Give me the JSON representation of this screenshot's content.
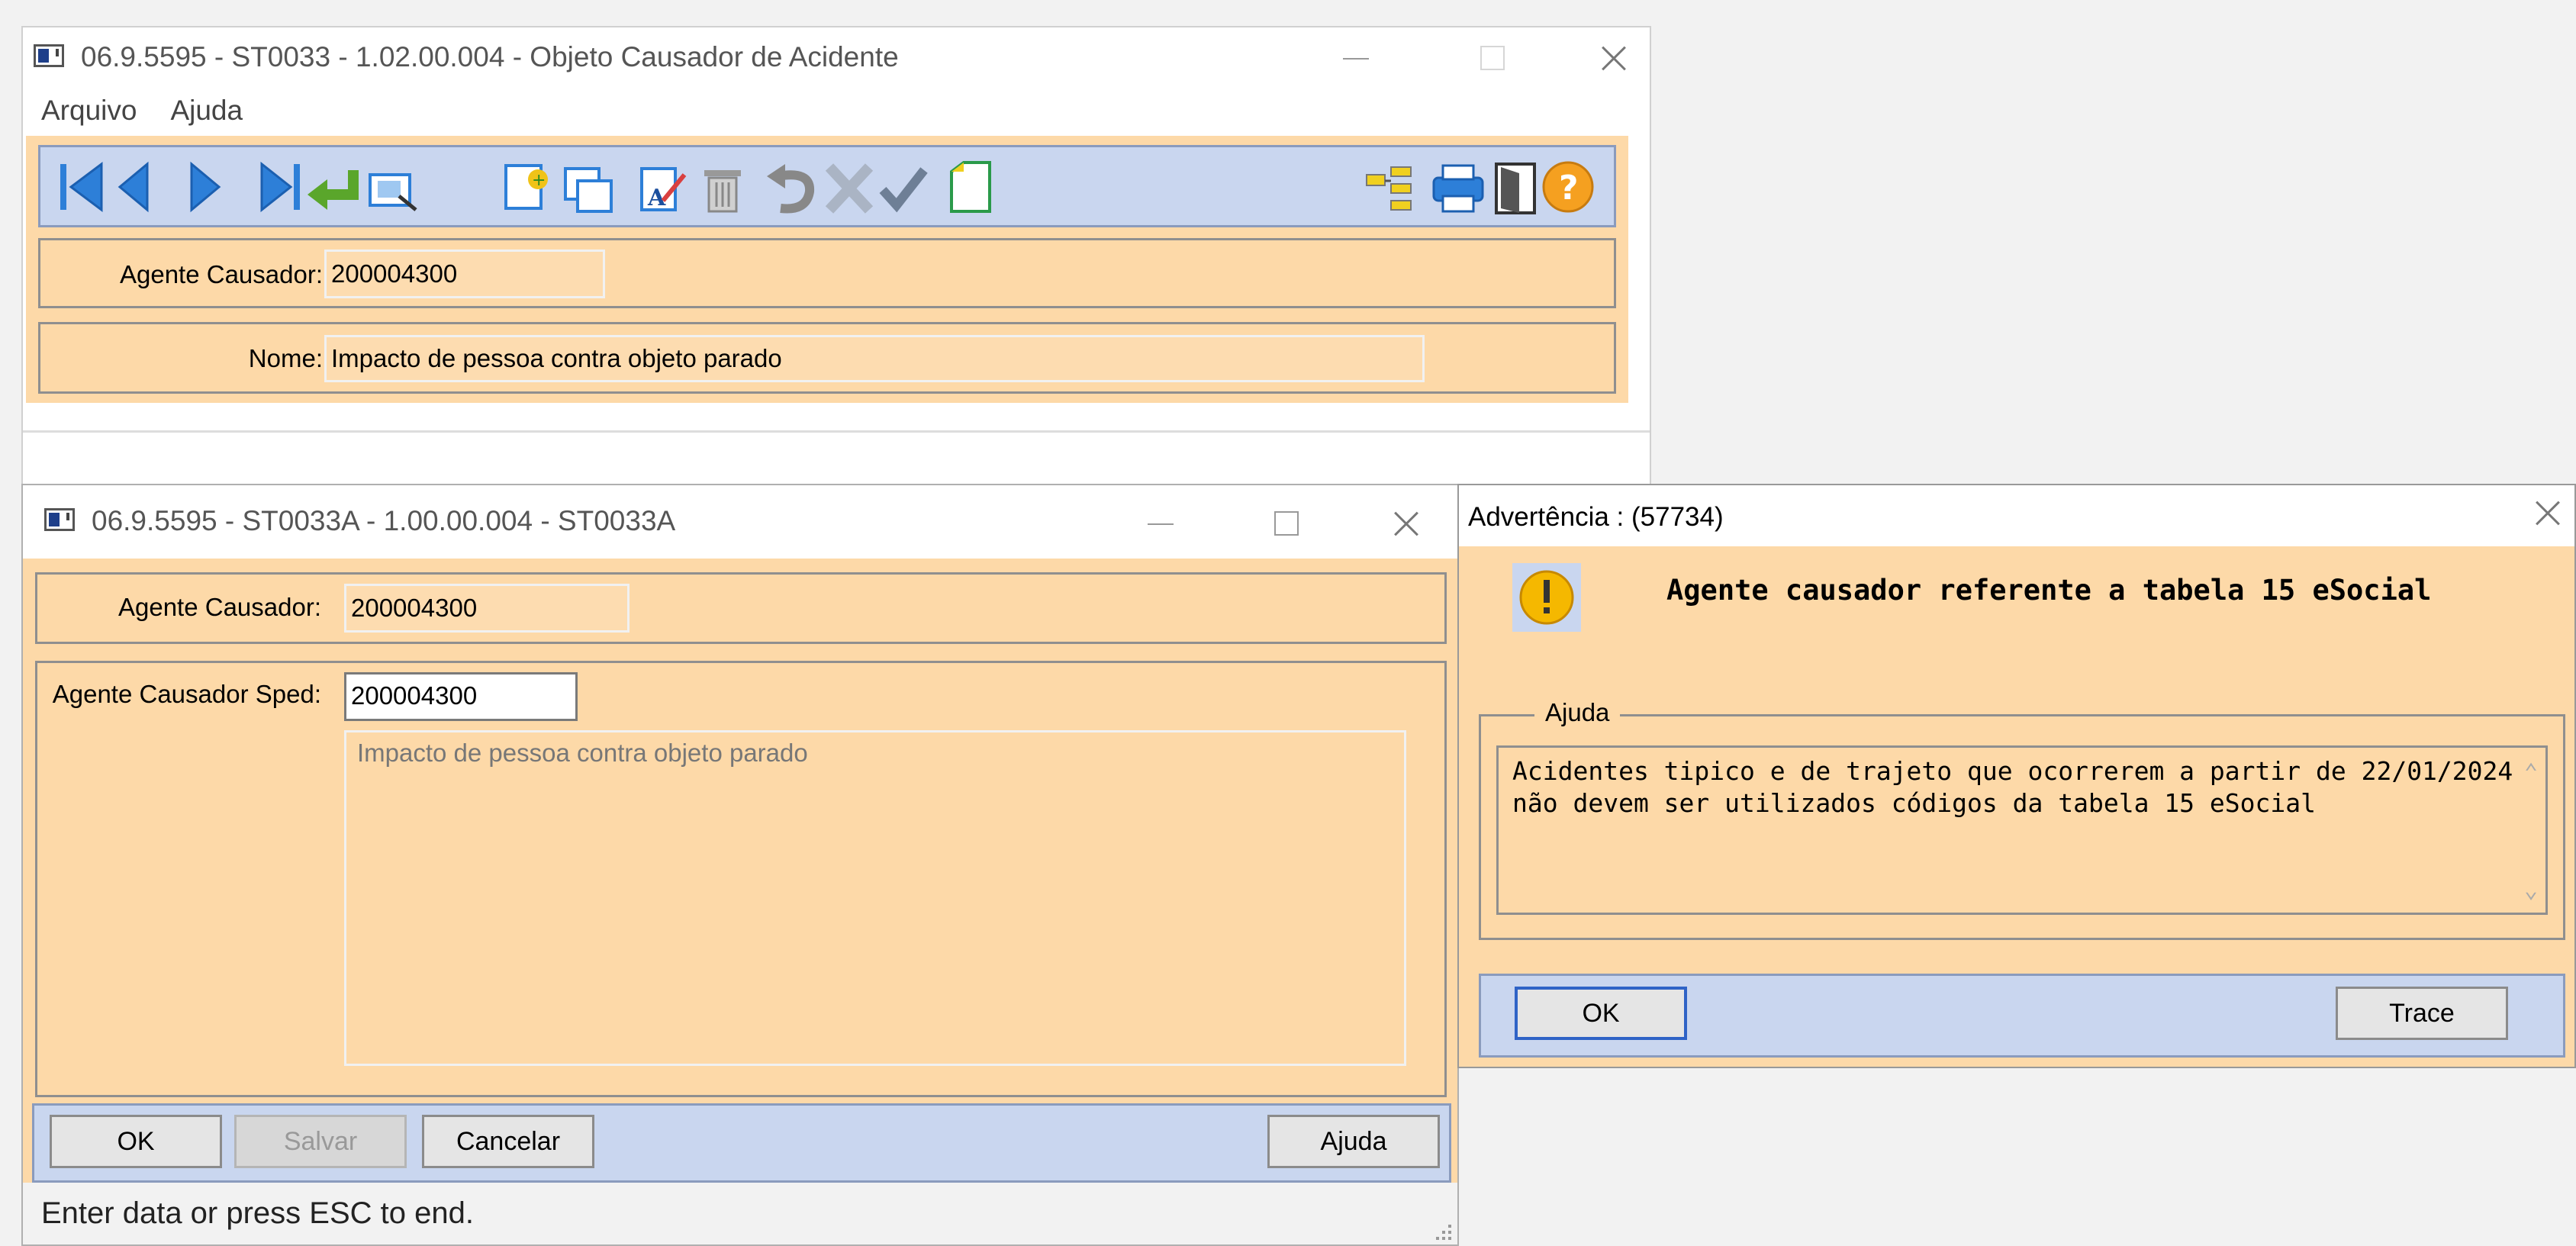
{
  "win1": {
    "title": "06.9.5595 - ST0033 - 1.02.00.004 - Objeto Causador de Acidente",
    "menu": [
      "Arquivo",
      "Ajuda"
    ],
    "fields": {
      "agente_label": "Agente Causador:",
      "agente_value": "200004300",
      "nome_label": "Nome:",
      "nome_value": "Impacto de pessoa contra objeto parado"
    }
  },
  "win2": {
    "title": "06.9.5595 - ST0033A - 1.00.00.004 - ST0033A",
    "fields": {
      "agente_label": "Agente Causador:",
      "agente_value": "200004300",
      "sped_label": "Agente Causador Sped:",
      "sped_value": "200004300",
      "description": "Impacto de pessoa contra objeto parado"
    },
    "buttons": {
      "ok": "OK",
      "salvar": "Salvar",
      "cancelar": "Cancelar",
      "ajuda": "Ajuda"
    },
    "status": "Enter data or press ESC to end."
  },
  "warning": {
    "title": "Advertência : (57734)",
    "heading": "Agente causador referente a tabela 15 eSocial",
    "group_label": "Ajuda",
    "message_line1": "Acidentes tipico e de trajeto que ocorrerem a partir de 22/01/2024",
    "message_line2": "não devem ser utilizados códigos da tabela 15 eSocial",
    "buttons": {
      "ok": "OK",
      "trace": "Trace"
    }
  },
  "colors": {
    "panel": "#fdd9a8",
    "toolbar": "#c9d6ef",
    "accent_blue": "#2f63c6"
  }
}
